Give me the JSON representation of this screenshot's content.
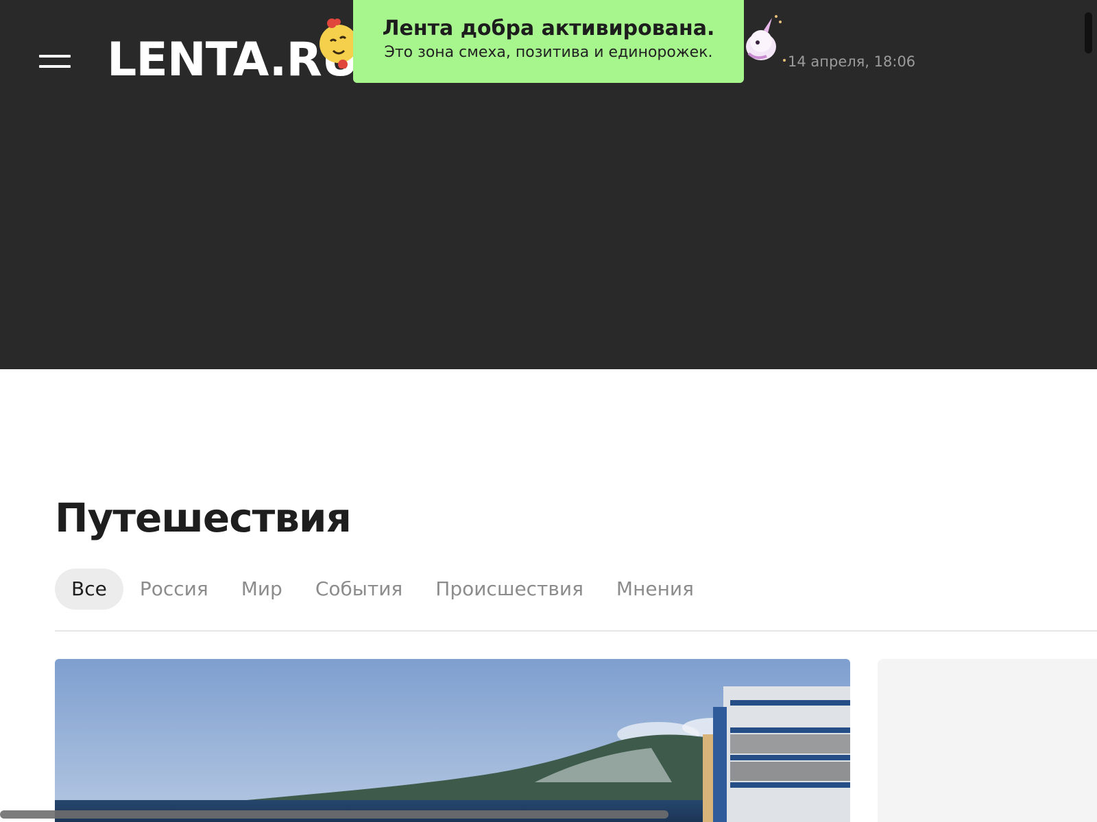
{
  "header": {
    "logo_text": "LENTA.RU",
    "date_time": "14 апреля, 18:06"
  },
  "toast": {
    "title": "Лента добра активирована.",
    "subtitle": "Это зона смеха, позитива и единорожек."
  },
  "section": {
    "title": "Путешествия"
  },
  "tabs": [
    {
      "label": "Все",
      "active": true
    },
    {
      "label": "Россия",
      "active": false
    },
    {
      "label": "Мир",
      "active": false
    },
    {
      "label": "События",
      "active": false
    },
    {
      "label": "Происшествия",
      "active": false
    },
    {
      "label": "Мнения",
      "active": false
    }
  ],
  "icons": {
    "menu": "hamburger-menu-icon",
    "smiley": "smiley-bows-icon",
    "unicorn": "unicorn-icon"
  },
  "colors": {
    "header_bg": "#292929",
    "toast_bg": "#a6f58d",
    "active_tab_bg": "#ececec"
  }
}
